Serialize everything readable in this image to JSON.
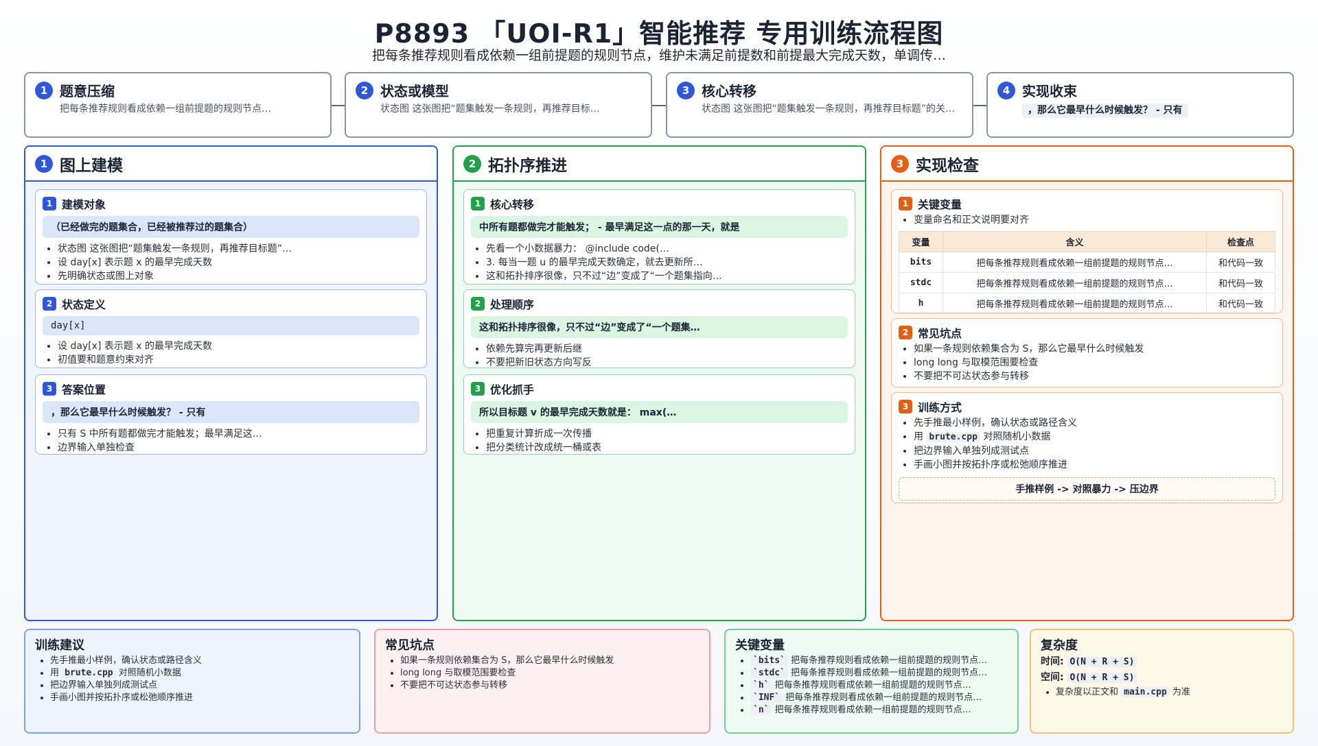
{
  "header": {
    "title": "P8893 「UOI-R1」智能推荐 专用训练流程图",
    "subtitle": "把每条推荐规则看成依赖一组前提题的规则节点，维护未满足前提数和前提最大完成天数，单调传…"
  },
  "steps": [
    {
      "num": "1",
      "title": "题意压缩",
      "desc": "把每条推荐规则看成依赖一组前提题的规则节点…"
    },
    {
      "num": "2",
      "title": "状态或模型",
      "desc": "状态图 这张图把“题集触发一条规则，再推荐目标…"
    },
    {
      "num": "3",
      "title": "核心转移",
      "desc": "状态图 这张图把“题集触发一条规则，再推荐目标题”的关…"
    },
    {
      "num": "4",
      "title": "实现收束",
      "desc": "，那么它最早什么时候触发？ - 只有"
    }
  ],
  "columns": {
    "modeling": {
      "num": "1",
      "title": "图上建模",
      "cards": [
        {
          "num": "1",
          "title": "建模对象",
          "highlight": "（已经做完的题集合，已经被推荐过的题集合）",
          "bullets": [
            "状态图 这张图把“题集触发一条规则，再推荐目标题”…",
            "设 day[x] 表示题 x 的最早完成天数",
            "先明确状态或图上对象"
          ]
        },
        {
          "num": "2",
          "title": "状态定义",
          "highlight": "day[x]",
          "bullets": [
            "设 day[x] 表示题 x 的最早完成天数",
            "初值要和题意约束对齐"
          ]
        },
        {
          "num": "3",
          "title": "答案位置",
          "highlight": "，那么它最早什么时候触发？ - 只有",
          "bullets": [
            "只有 S 中所有题都做完才能触发；最早满足这…",
            "边界输入单独检查"
          ]
        }
      ]
    },
    "topo": {
      "num": "2",
      "title": "拓扑序推进",
      "cards": [
        {
          "num": "1",
          "title": "核心转移",
          "highlight": "中所有题都做完才能触发； - 最早满足这一点的那一天，就是",
          "bullets": [
            "先看一个小数据暴力： @include code(…",
            "3. 每当一题 u 的最早完成天数确定，就去更新所…",
            "这和拓扑排序很像，只不过“边”变成了“一个题集指向…"
          ]
        },
        {
          "num": "2",
          "title": "处理顺序",
          "highlight": "这和拓扑排序很像，只不过“边”变成了“一个题集…",
          "bullets": [
            "依赖先算完再更新后继",
            "不要把新旧状态方向写反"
          ]
        },
        {
          "num": "3",
          "title": "优化抓手",
          "highlight": "所以目标题 v 的最早完成天数就是： max(…",
          "bullets": [
            "把重复计算折成一次传播",
            "把分类统计改成统一桶或表"
          ]
        }
      ]
    },
    "impl": {
      "num": "3",
      "title": "实现检查",
      "vars_card": {
        "num": "1",
        "title": "关键变量",
        "note": "变量命名和正文说明要对齐",
        "headers": [
          "变量",
          "含义",
          "检查点"
        ],
        "rows": [
          {
            "name": "bits",
            "meaning": "把每条推荐规则看成依赖一组前提题的规则节点…",
            "check": "和代码一致"
          },
          {
            "name": "stdc",
            "meaning": "把每条推荐规则看成依赖一组前提题的规则节点…",
            "check": "和代码一致"
          },
          {
            "name": "h",
            "meaning": "把每条推荐规则看成依赖一组前提题的规则节点…",
            "check": "和代码一致"
          }
        ]
      },
      "pitfalls_card": {
        "num": "2",
        "title": "常见坑点",
        "bullets": [
          "如果一条规则依赖集合为 S，那么它最早什么时候触发",
          "long long 与取模范围要检查",
          "不要把不可达状态参与转移"
        ]
      },
      "training_card": {
        "num": "3",
        "title": "训练方式",
        "b1": "先手推最小样例，确认状态或路径含义",
        "b2_pre": "用",
        "b2_code": "brute.cpp",
        "b2_post": "对照随机小数据",
        "b3": "把边界输入单独列成测试点",
        "b4": "手画小图并按拓扑序或松弛顺序推进",
        "flow": "手推样例 -> 对照暴力 -> 压边界"
      }
    }
  },
  "bottom": {
    "advice": {
      "title": "训练建议",
      "b1": "先手推最小样例，确认状态或路径含义",
      "b2_pre": "用",
      "b2_code": "brute.cpp",
      "b2_post": "对照随机小数据",
      "b3": "把边界输入单独列成测试点",
      "b4": "手画小图并按拓扑序或松弛顺序推进"
    },
    "pitfalls": {
      "title": "常见坑点",
      "bullets": [
        "如果一条规则依赖集合为 S，那么它最早什么时候触发",
        "long long 与取模范围要检查",
        "不要把不可达状态参与转移"
      ]
    },
    "vars": {
      "title": "关键变量",
      "items": [
        {
          "code": "`bits`",
          "text": "把每条推荐规则看成依赖一组前提题的规则节点…"
        },
        {
          "code": "`stdc`",
          "text": "把每条推荐规则看成依赖一组前提题的规则节点…"
        },
        {
          "code": "`h`",
          "text": "把每条推荐规则看成依赖一组前提题的规则节点…"
        },
        {
          "code": "`INF`",
          "text": "把每条推荐规则看成依赖一组前提题的规则节点…"
        },
        {
          "code": "`n`",
          "text": "把每条推荐规则看成依赖一组前提题的规则节点…"
        }
      ]
    },
    "complexity": {
      "title": "复杂度",
      "time_label": "时间:",
      "time": "O(N + R + S)",
      "space_label": "空间:",
      "space": "O(N + R + S)",
      "note_pre": "复杂度以正文和",
      "note_code": "main.cpp",
      "note_post": "为准"
    }
  },
  "colors": {
    "blue": "#2f57d6",
    "green": "#22a14a",
    "orange": "#e35f14"
  }
}
